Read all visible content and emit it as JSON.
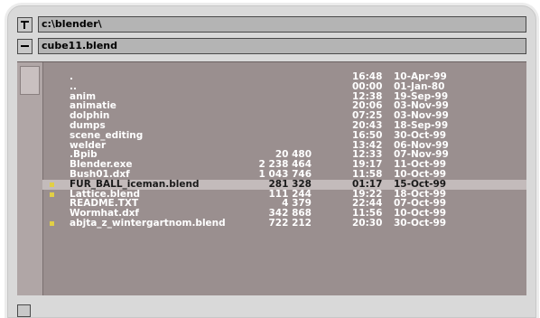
{
  "header": {
    "dir_path": "c:\\blender\\",
    "file_name": "cube11.blend"
  },
  "files": [
    {
      "name": ".",
      "size": "",
      "time": "16:48",
      "date": "10-Apr-99",
      "blend": false
    },
    {
      "name": "..",
      "size": "",
      "time": "00:00",
      "date": "01-Jan-80",
      "blend": false
    },
    {
      "name": "anim",
      "size": "",
      "time": "12:38",
      "date": "19-Sep-99",
      "blend": false
    },
    {
      "name": "animatie",
      "size": "",
      "time": "20:06",
      "date": "03-Nov-99",
      "blend": false
    },
    {
      "name": "dolphin",
      "size": "",
      "time": "07:25",
      "date": "03-Nov-99",
      "blend": false
    },
    {
      "name": "dumps",
      "size": "",
      "time": "20:43",
      "date": "18-Sep-99",
      "blend": false
    },
    {
      "name": "scene_editing",
      "size": "",
      "time": "16:50",
      "date": "30-Oct-99",
      "blend": false
    },
    {
      "name": "welder",
      "size": "",
      "time": "13:42",
      "date": "06-Nov-99",
      "blend": false
    },
    {
      "name": ".Bpib",
      "size": "20 480",
      "time": "12:33",
      "date": "07-Nov-99",
      "blend": false
    },
    {
      "name": "Blender.exe",
      "size": "2 238 464",
      "time": "19:17",
      "date": "11-Oct-99",
      "blend": false
    },
    {
      "name": "Bush01.dxf",
      "size": "1 043 746",
      "time": "11:58",
      "date": "10-Oct-99",
      "blend": false
    },
    {
      "name": "FUR_BALL_iceman.blend",
      "size": "281 328",
      "time": "01:17",
      "date": "15-Oct-99",
      "blend": true
    },
    {
      "name": "Lattice.blend",
      "size": "111 244",
      "time": "19:22",
      "date": "18-Oct-99",
      "blend": true
    },
    {
      "name": "README.TXT",
      "size": "4 379",
      "time": "22:44",
      "date": "07-Oct-99",
      "blend": false
    },
    {
      "name": "Wormhat.dxf",
      "size": "342 868",
      "time": "11:56",
      "date": "10-Oct-99",
      "blend": false
    },
    {
      "name": "abjta_z_wintergartnom.blend",
      "size": "722 212",
      "time": "20:30",
      "date": "30-Oct-99",
      "blend": true
    }
  ],
  "highlighted_row": 11,
  "icons": {
    "parent_dir": "parent-dir-icon",
    "minus": "minus-icon",
    "blend_marker": "blend-file-marker-icon"
  },
  "colors": {
    "list_bg": "#9a8f8f",
    "highlight_bg": "#c3bbbb",
    "text": "#ffffff",
    "blend_marker": "#e1cf45"
  }
}
